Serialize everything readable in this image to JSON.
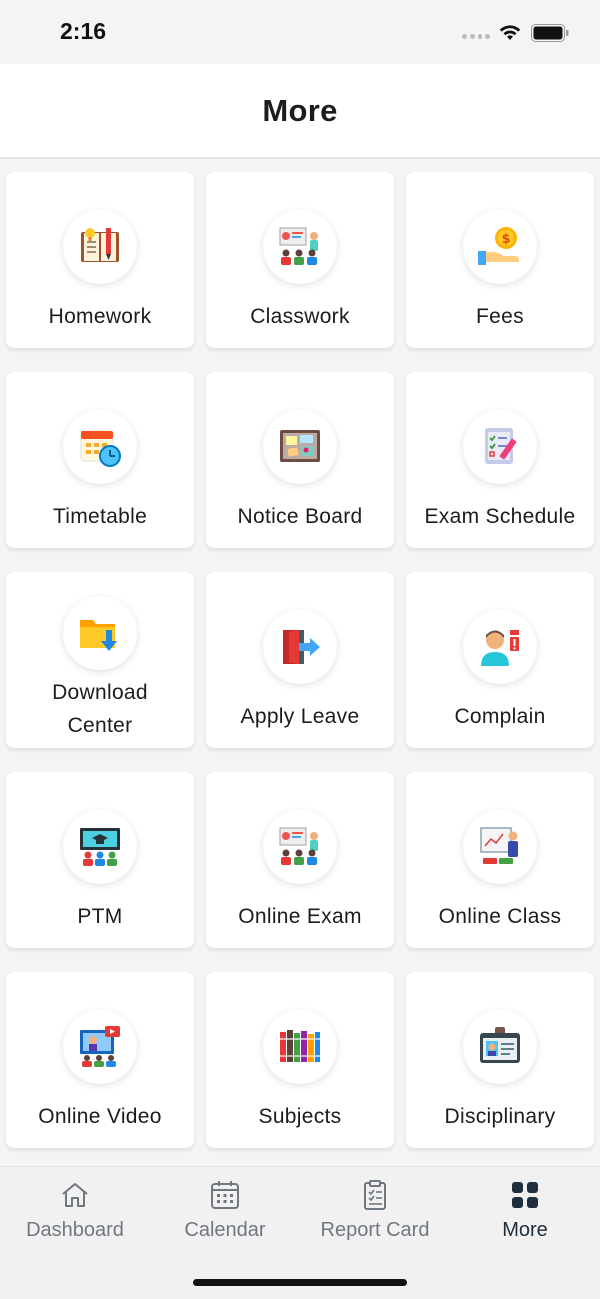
{
  "status_bar": {
    "time": "2:16"
  },
  "header": {
    "title": "More"
  },
  "menu": [
    {
      "label": "Homework",
      "icon": "homework-book-icon"
    },
    {
      "label": "Classwork",
      "icon": "classroom-icon"
    },
    {
      "label": "Fees",
      "icon": "coin-hand-icon"
    },
    {
      "label": "Timetable",
      "icon": "calendar-clock-icon"
    },
    {
      "label": "Notice Board",
      "icon": "notice-board-icon"
    },
    {
      "label": "Exam Schedule",
      "icon": "checklist-pencil-icon"
    },
    {
      "label_line1": "Download",
      "label_line2": "Center",
      "icon": "folder-download-icon"
    },
    {
      "label": "Apply Leave",
      "icon": "exit-door-icon"
    },
    {
      "label": "Complain",
      "icon": "person-alert-icon"
    },
    {
      "label": "PTM",
      "icon": "graduation-screen-icon"
    },
    {
      "label": "Online Exam",
      "icon": "classroom-icon"
    },
    {
      "label": "Online Class",
      "icon": "teacher-whiteboard-icon"
    },
    {
      "label": "Online Video",
      "icon": "video-presentation-icon"
    },
    {
      "label": "Subjects",
      "icon": "books-icon"
    },
    {
      "label": "Disciplinary",
      "icon": "id-card-icon"
    }
  ],
  "tab_bar": {
    "tabs": [
      {
        "label": "Dashboard",
        "icon": "home-icon"
      },
      {
        "label": "Calendar",
        "icon": "calendar-icon"
      },
      {
        "label": "Report Card",
        "icon": "clipboard-icon"
      },
      {
        "label": "More",
        "icon": "grid-icon"
      }
    ],
    "active_tab": "More"
  },
  "colors": {
    "background": "#f4f4f4",
    "tile": "#ffffff",
    "text": "#1c1c1c",
    "tab_inactive": "#707781",
    "tab_active": "#1f2f3d"
  }
}
